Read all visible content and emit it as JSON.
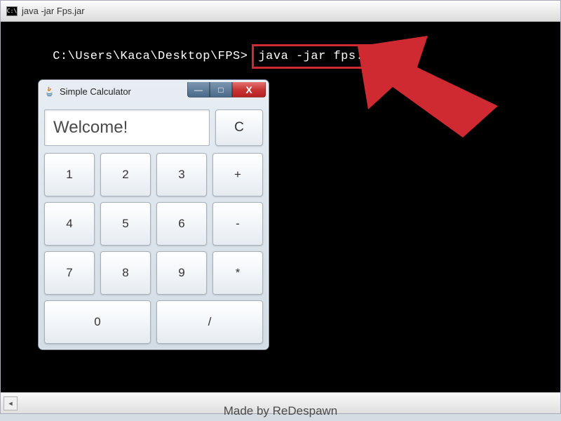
{
  "console": {
    "icon_text": "C:\\",
    "title": "java  -jar Fps.jar",
    "prompt": "C:\\Users\\Kaca\\Desktop\\FPS>",
    "command": "java -jar fps.jar",
    "scroll_left_glyph": "◄"
  },
  "calculator": {
    "title": "Simple Calculator",
    "display_text": "Welcome!",
    "clear_label": "C",
    "buttons": {
      "r1c1": "1",
      "r1c2": "2",
      "r1c3": "3",
      "r1c4": "+",
      "r2c1": "4",
      "r2c2": "5",
      "r2c3": "6",
      "r2c4": "-",
      "r3c1": "7",
      "r3c2": "8",
      "r3c3": "9",
      "r3c4": "*",
      "r4c1": "0",
      "r4c2": "/"
    },
    "win_buttons": {
      "min": "—",
      "max": "□",
      "close": "X"
    }
  },
  "footer": "Made by ReDespawn",
  "arrow_color": "#cf2a31"
}
